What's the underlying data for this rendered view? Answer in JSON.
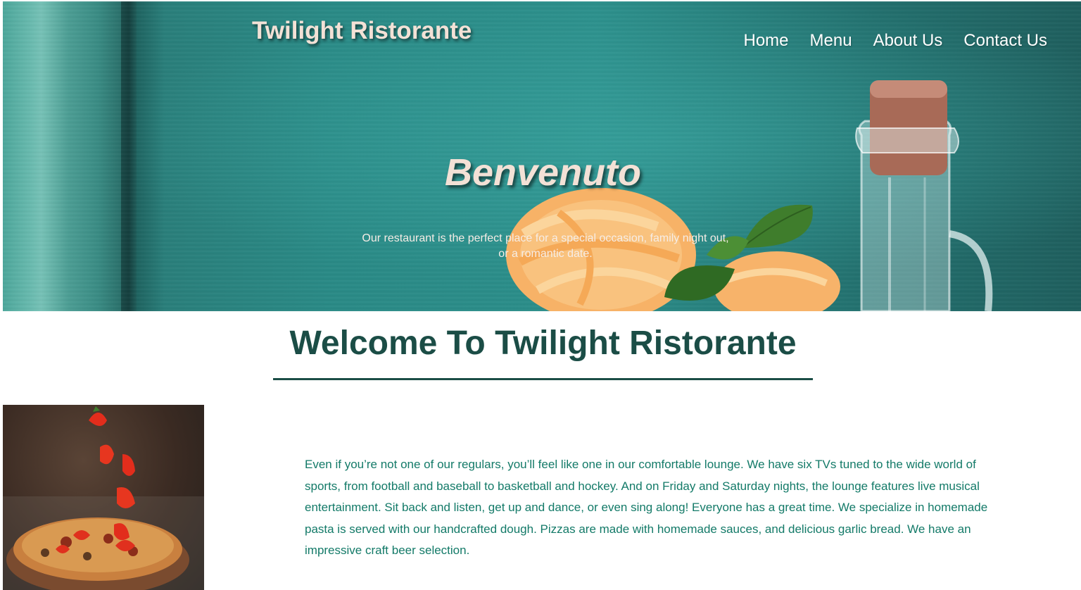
{
  "header": {
    "brand": "Twilight Ristorante",
    "nav": [
      {
        "label": "Home"
      },
      {
        "label": "Menu"
      },
      {
        "label": "About Us"
      },
      {
        "label": "Contact Us"
      }
    ]
  },
  "hero": {
    "title": "Benvenuto",
    "subtitle": "Our restaurant is the perfect place for a special occasion, family night out, or a romantic date."
  },
  "welcome": {
    "heading": "Welcome To Twilight Ristorante"
  },
  "about": {
    "paragraph": "Even if you’re not one of our regulars, you’ll feel like one in our comfortable lounge. We have six TVs tuned to the wide world of sports, from football and baseball to basketball and hockey. And on Friday and Saturday nights, the lounge features live musical entertainment. Sit back and listen, get up and dance, or even sing along! Everyone has a great time. We specialize in homemade pasta is served with our handcrafted dough. Pizzas are made with homemade sauces, and delicious garlic bread. We have an impressive craft beer selection."
  },
  "colors": {
    "hero_teal": "#2a8a86",
    "brand_cream": "#f3e1d6",
    "heading_green": "#1b4d46",
    "body_text_teal": "#137a68"
  }
}
